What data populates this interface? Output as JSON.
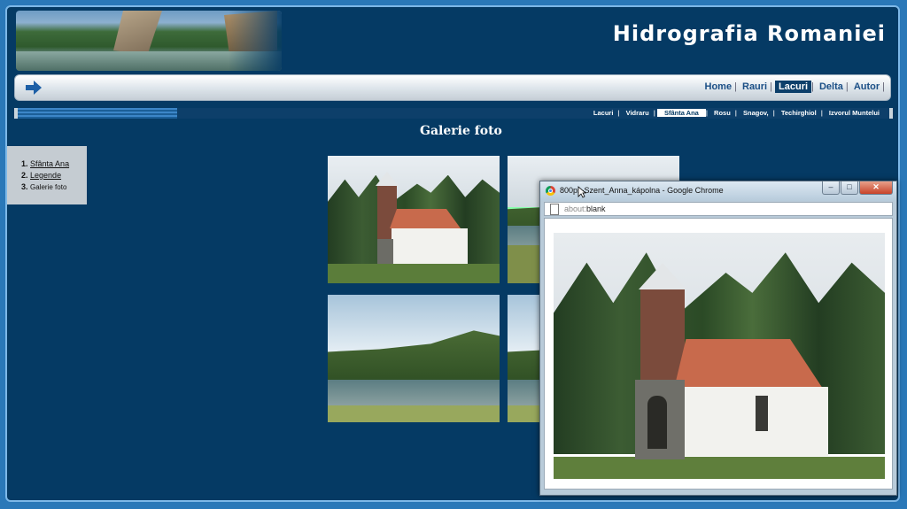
{
  "site": {
    "title": "Hidrografia  Romaniei"
  },
  "nav": {
    "items": [
      {
        "label": "Home",
        "active": false
      },
      {
        "label": "Rauri",
        "active": false
      },
      {
        "label": "Lacuri",
        "active": true
      },
      {
        "label": "Delta",
        "active": false
      },
      {
        "label": "Autor",
        "active": false
      }
    ]
  },
  "subnav": {
    "items": [
      {
        "label": "Lacuri",
        "active": false
      },
      {
        "label": "Vidraru",
        "active": false
      },
      {
        "label": "Sfânta Ana",
        "active": true
      },
      {
        "label": "Rosu",
        "active": false
      },
      {
        "label": "Snagov,",
        "active": false
      },
      {
        "label": "Techirghiol",
        "active": false
      },
      {
        "label": "Izvorul Muntelui",
        "active": false
      }
    ]
  },
  "page": {
    "heading": "Galerie foto"
  },
  "side_menu": {
    "items": [
      {
        "num": "1.",
        "label": "Sfânta Ana",
        "link": true
      },
      {
        "num": "2.",
        "label": "Legende",
        "link": true
      },
      {
        "num": "3.",
        "label": "Galerie foto",
        "link": false
      }
    ]
  },
  "popup": {
    "title": "800px-Szent_Anna_kápolna - Google Chrome",
    "address_scheme": "about:",
    "address_rest": "blank",
    "buttons": {
      "minimize": "–",
      "maximize": "□",
      "close": "✕"
    }
  },
  "icons": {
    "nav_arrow": "arrow-right-icon",
    "browser": "chrome-icon",
    "page": "page-icon"
  },
  "colors": {
    "background": "#053a64",
    "accent": "#0d3f6a",
    "nav_text": "#1b4f86"
  }
}
